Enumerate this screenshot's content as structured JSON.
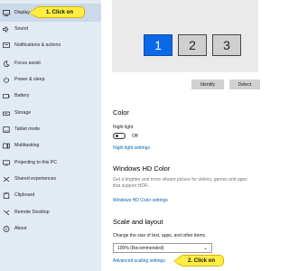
{
  "sidebar": {
    "items": [
      {
        "label": "Display",
        "icon": "monitor-icon"
      },
      {
        "label": "Sound",
        "icon": "speaker-icon"
      },
      {
        "label": "Notifications & actions",
        "icon": "notification-icon"
      },
      {
        "label": "Focus assist",
        "icon": "moon-icon"
      },
      {
        "label": "Power & sleep",
        "icon": "power-icon"
      },
      {
        "label": "Battery",
        "icon": "battery-icon"
      },
      {
        "label": "Storage",
        "icon": "storage-icon"
      },
      {
        "label": "Tablet mode",
        "icon": "tablet-icon"
      },
      {
        "label": "Multitasking",
        "icon": "multitasking-icon"
      },
      {
        "label": "Projecting to this PC",
        "icon": "projector-icon"
      },
      {
        "label": "Shared experiences",
        "icon": "share-icon"
      },
      {
        "label": "Clipboard",
        "icon": "clipboard-icon"
      },
      {
        "label": "Remote Desktop",
        "icon": "remote-icon"
      },
      {
        "label": "About",
        "icon": "info-icon"
      }
    ]
  },
  "callouts": {
    "one": "1. Click on",
    "two": "2. Click on"
  },
  "display": {
    "monitors": [
      "1",
      "2",
      "3"
    ],
    "identify_label": "Identify",
    "detect_label": "Detect"
  },
  "color": {
    "heading": "Color",
    "night_light_label": "Night light",
    "toggle_state": "Off",
    "night_light_settings_link": "Night light settings"
  },
  "hdr": {
    "heading": "Windows HD Color",
    "description": "Get a brighter and more vibrant picture for videos, games and apps that support HDR.",
    "settings_link": "Windows HD Color settings"
  },
  "scale": {
    "heading": "Scale and layout",
    "change_size_label": "Change the size of text, apps, and other items",
    "selected_value": "100% (Recommended)",
    "advanced_link": "Advanced scaling settings"
  },
  "colors": {
    "sidebar_bg": "#e2eaf3",
    "active_item_bg": "#cbd9e9",
    "selected_monitor": "#0b68e6",
    "link": "#0063b1",
    "callout": "#ffee44"
  }
}
